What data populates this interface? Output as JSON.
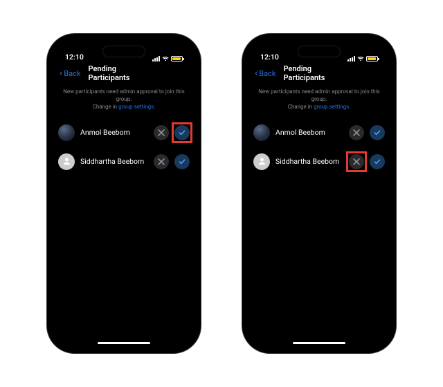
{
  "statusBar": {
    "time": "12:10"
  },
  "nav": {
    "back": "Back",
    "title": "Pending Participants"
  },
  "info": {
    "line1": "New participants need admin approval to join this group.",
    "prefix": "Change in ",
    "link": "group settings",
    "suffix": "."
  },
  "participants": [
    {
      "name": "Anmol Beebom",
      "avatar": "photo"
    },
    {
      "name": "Siddhartha Beebom",
      "avatar": "placeholder"
    }
  ]
}
